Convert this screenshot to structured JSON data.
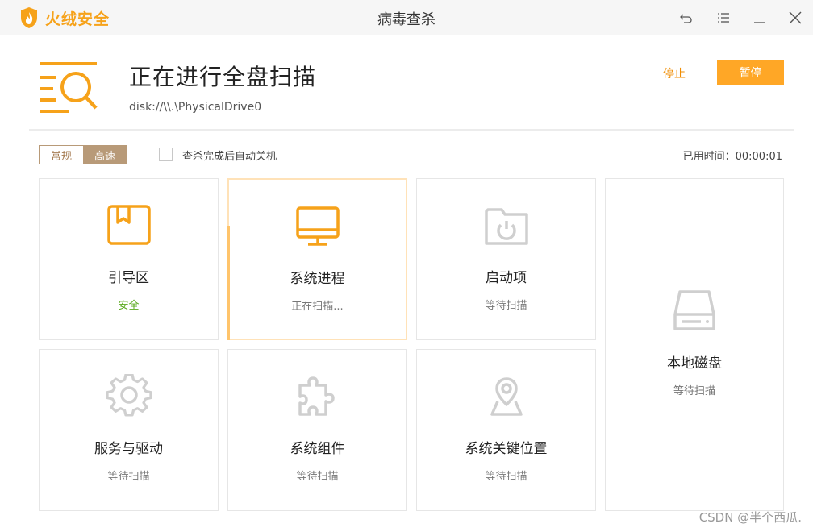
{
  "app": {
    "brand_name": "火绒安全",
    "window_title": "病毒查杀",
    "brand_color": "#f6a21a"
  },
  "window_controls": [
    {
      "name": "back-icon"
    },
    {
      "name": "menu-icon"
    },
    {
      "name": "minimize-icon"
    },
    {
      "name": "close-icon"
    }
  ],
  "header": {
    "title": "正在进行全盘扫描",
    "target": "disk://\\\\.\\PhysicalDrive0",
    "stop_label": "停止",
    "pause_label": "暂停",
    "accent_color": "#ffa726"
  },
  "options": {
    "mode_normal": "常规",
    "mode_fast": "高速",
    "selected_mode": "高速",
    "auto_shutdown_label": "查杀完成后自动关机",
    "auto_shutdown_checked": false,
    "elapsed_label": "已用时间：00:00:01"
  },
  "cards": {
    "boot": {
      "name": "引导区",
      "status": "安全",
      "icon": "bookmark-folder-icon"
    },
    "process": {
      "name": "系统进程",
      "status": "正在扫描...",
      "icon": "monitor-icon"
    },
    "startup": {
      "name": "启动项",
      "status": "等待扫描",
      "icon": "power-folder-icon"
    },
    "disk": {
      "name": "本地磁盘",
      "status": "等待扫描",
      "icon": "hard-drive-icon"
    },
    "services": {
      "name": "服务与驱动",
      "status": "等待扫描",
      "icon": "gear-icon"
    },
    "components": {
      "name": "系统组件",
      "status": "等待扫描",
      "icon": "puzzle-icon"
    },
    "key_locations": {
      "name": "系统关键位置",
      "status": "等待扫描",
      "icon": "location-pin-icon"
    }
  },
  "watermark": "CSDN @半个西瓜."
}
